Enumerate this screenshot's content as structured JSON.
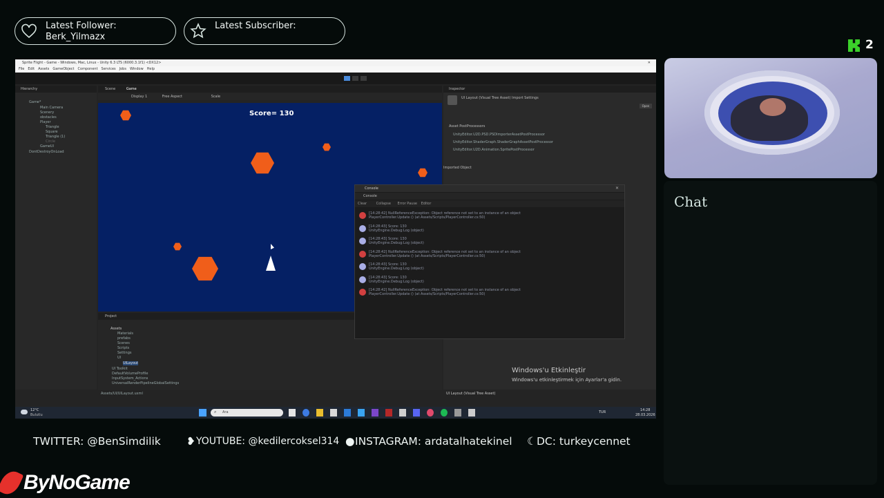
{
  "alerts": {
    "follower_label": "Latest Follower:",
    "follower_name": "Berk_Yilmazx",
    "subscriber_label": "Latest Subscriber:",
    "subscriber_name": ""
  },
  "kick": {
    "count": "2"
  },
  "unity": {
    "window_title": "Sprite Flight - Game - Windows, Mac, Linux - Unity 6.3 LTS (6000.3.1f1) <DX12>",
    "menu": [
      "File",
      "Edit",
      "Assets",
      "GameObject",
      "Component",
      "Services",
      "Jobs",
      "Window",
      "Help"
    ],
    "hierarchy_tab": "Hierarchy",
    "hierarchy_items": [
      "Game*",
      "Main Camera",
      "Scenery",
      "obstacles",
      "Player",
      "Triangle",
      "Square",
      "Triangle (1)",
      "Circle",
      "GameUI",
      "DontDestroyOnLoad"
    ],
    "scene_tab": "Scene",
    "game_tab": "Game",
    "game_display": "Display 1",
    "game_aspect": "Free Aspect",
    "game_scale": "Scale",
    "score_text": "Score= 130",
    "inspector_tab": "Inspector",
    "inspector_title": "UI Layout (Visual Tree Asset) Import Settings",
    "project_tab": "Project",
    "project_root": "Assets",
    "project_items": [
      "Materials",
      "prefabs",
      "Scenes",
      "Scripts",
      "Settings",
      "UI",
      "UILayout",
      "UI Toolkit",
      "DefaultVolumeProfile",
      "InputSystem_Actions",
      "UniversalRenderPipelineGlobalSettings"
    ],
    "console_title": "Console",
    "console_tab": "Console",
    "console_toolbar": [
      "Clear",
      "Collapse",
      "Error Pause",
      "Editor"
    ],
    "console_rows": [
      {
        "kind": "error",
        "line1": "[14:28:42] NullReferenceException: Object reference not set to an instance of an object",
        "line2": "PlayerController.Update () (at Assets/Scripts/PlayerController.cs:50)"
      },
      {
        "kind": "log",
        "line1": "[14:28:43] Score: 130",
        "line2": "UnityEngine.Debug:Log (object)"
      },
      {
        "kind": "log",
        "line1": "[14:28:43] Score: 130",
        "line2": "UnityEngine.Debug:Log (object)"
      },
      {
        "kind": "error",
        "line1": "[14:28:42] NullReferenceException: Object reference not set to an instance of an object",
        "line2": "PlayerController.Update () (at Assets/Scripts/PlayerController.cs:50)"
      },
      {
        "kind": "log",
        "line1": "[14:28:43] Score: 130",
        "line2": "UnityEngine.Debug:Log (object)"
      },
      {
        "kind": "log",
        "line1": "[14:28:43] Score: 130",
        "line2": "UnityEngine.Debug:Log (object)"
      },
      {
        "kind": "error",
        "line1": "[14:28:42] NullReferenceException: Object reference not set to an instance of an object",
        "line2": "PlayerController.Update () (at Assets/Scripts/PlayerController.cs:50)"
      }
    ],
    "activation_title": "Windows'u Etkinleştir",
    "activation_sub": "Windows'u etkinleştirmek için Ayarlar'a gidin.",
    "status_path": "Assets/UI/UILayout.uxml",
    "bottom_right_label": "UI Layout (Visual Tree Asset)"
  },
  "taskbar": {
    "weather_temp": "12°C",
    "weather_desc": "Bulutlu",
    "search_placeholder": "Ara",
    "lang": "TUR",
    "time": "14:28",
    "date": "28.03.2026"
  },
  "chat": {
    "label": "Chat"
  },
  "socials": {
    "twitter": "TWITTER: @BenSimdilik",
    "youtube": "YOUTUBE: @kedilercoksel314",
    "instagram": "INSTAGRAM: ardatalhatekinel",
    "discord": "DC: turkeycennet"
  },
  "brand": {
    "name": "ByNoGame"
  },
  "colors": {
    "game_bg": "#052064",
    "asteroid": "#f05e1a",
    "accent": "#3bd12a"
  }
}
